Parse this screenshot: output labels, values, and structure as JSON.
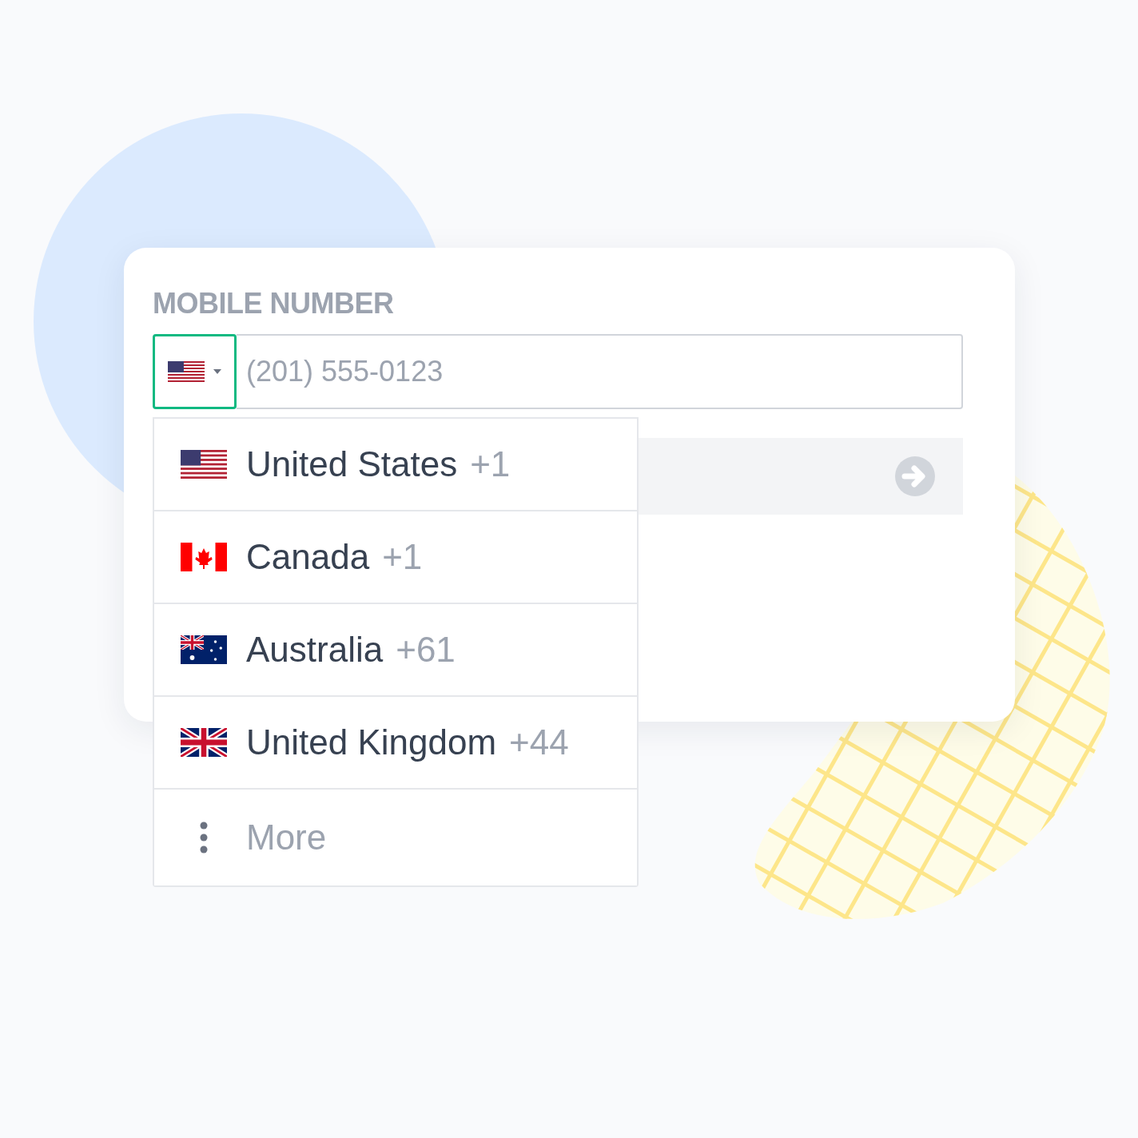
{
  "field": {
    "label": "MOBILE NUMBER",
    "placeholder": "(201) 555-0123"
  },
  "country_select": {
    "kind": "us",
    "focused": true,
    "expanded": true
  },
  "countries": [
    {
      "kind": "us",
      "name": "United States",
      "code": "+1"
    },
    {
      "kind": "ca",
      "name": "Canada",
      "code": "+1"
    },
    {
      "kind": "au",
      "name": "Australia",
      "code": "+61"
    },
    {
      "kind": "gb",
      "name": "United Kingdom",
      "code": "+44"
    }
  ],
  "more": {
    "label": "More"
  }
}
